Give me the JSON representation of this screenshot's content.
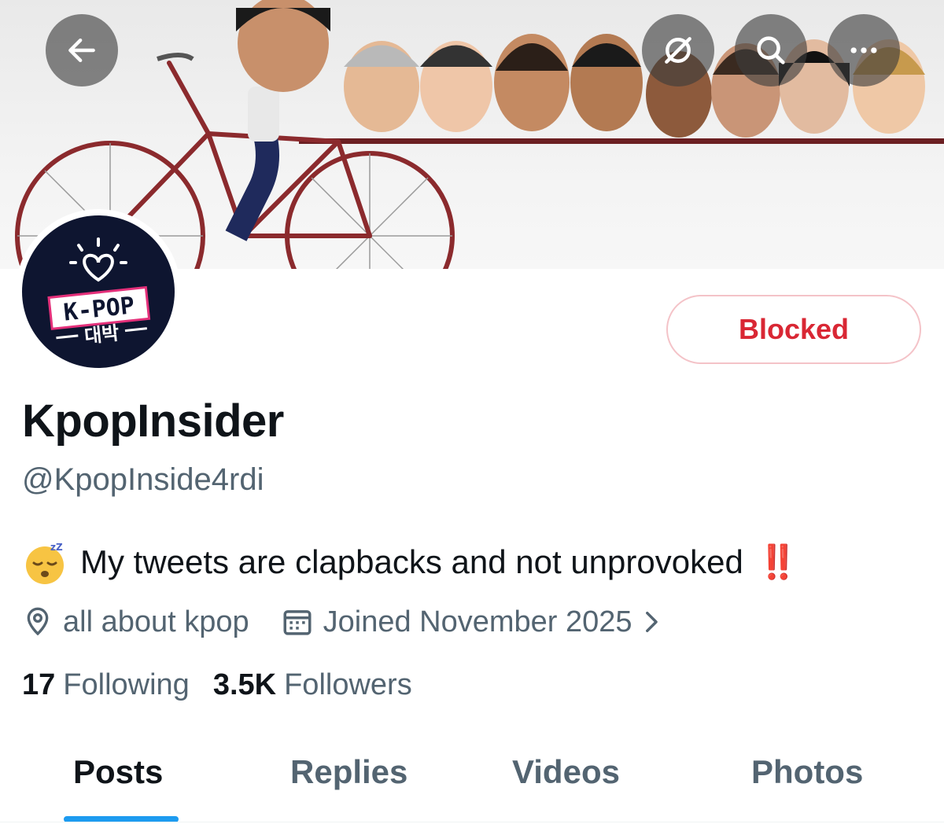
{
  "header": {
    "back_icon": "arrow-left-icon",
    "grok_icon": "grok-icon",
    "search_icon": "search-icon",
    "more_icon": "more-horizontal-icon"
  },
  "avatar": {
    "logo_top": "K-POP",
    "logo_bottom": "대박"
  },
  "actions": {
    "blocked_label": "Blocked",
    "blocked_color": "#d92734"
  },
  "profile": {
    "display_name": "KpopInsider",
    "handle": "@KpopInside4rdi",
    "bio_text": "My tweets are clapbacks and not unprovoked",
    "bio_bang": "‼️",
    "location": "all about kpop",
    "joined": "Joined November 2025",
    "following_count": "17",
    "following_label": "Following",
    "followers_count": "3.5K",
    "followers_label": "Followers"
  },
  "tabs": [
    {
      "label": "Posts",
      "active": true
    },
    {
      "label": "Replies",
      "active": false
    },
    {
      "label": "Videos",
      "active": false
    },
    {
      "label": "Photos",
      "active": false
    }
  ],
  "colors": {
    "accent": "#1d9bf0",
    "secondary_text": "#536471",
    "primary_text": "#0f1419"
  }
}
